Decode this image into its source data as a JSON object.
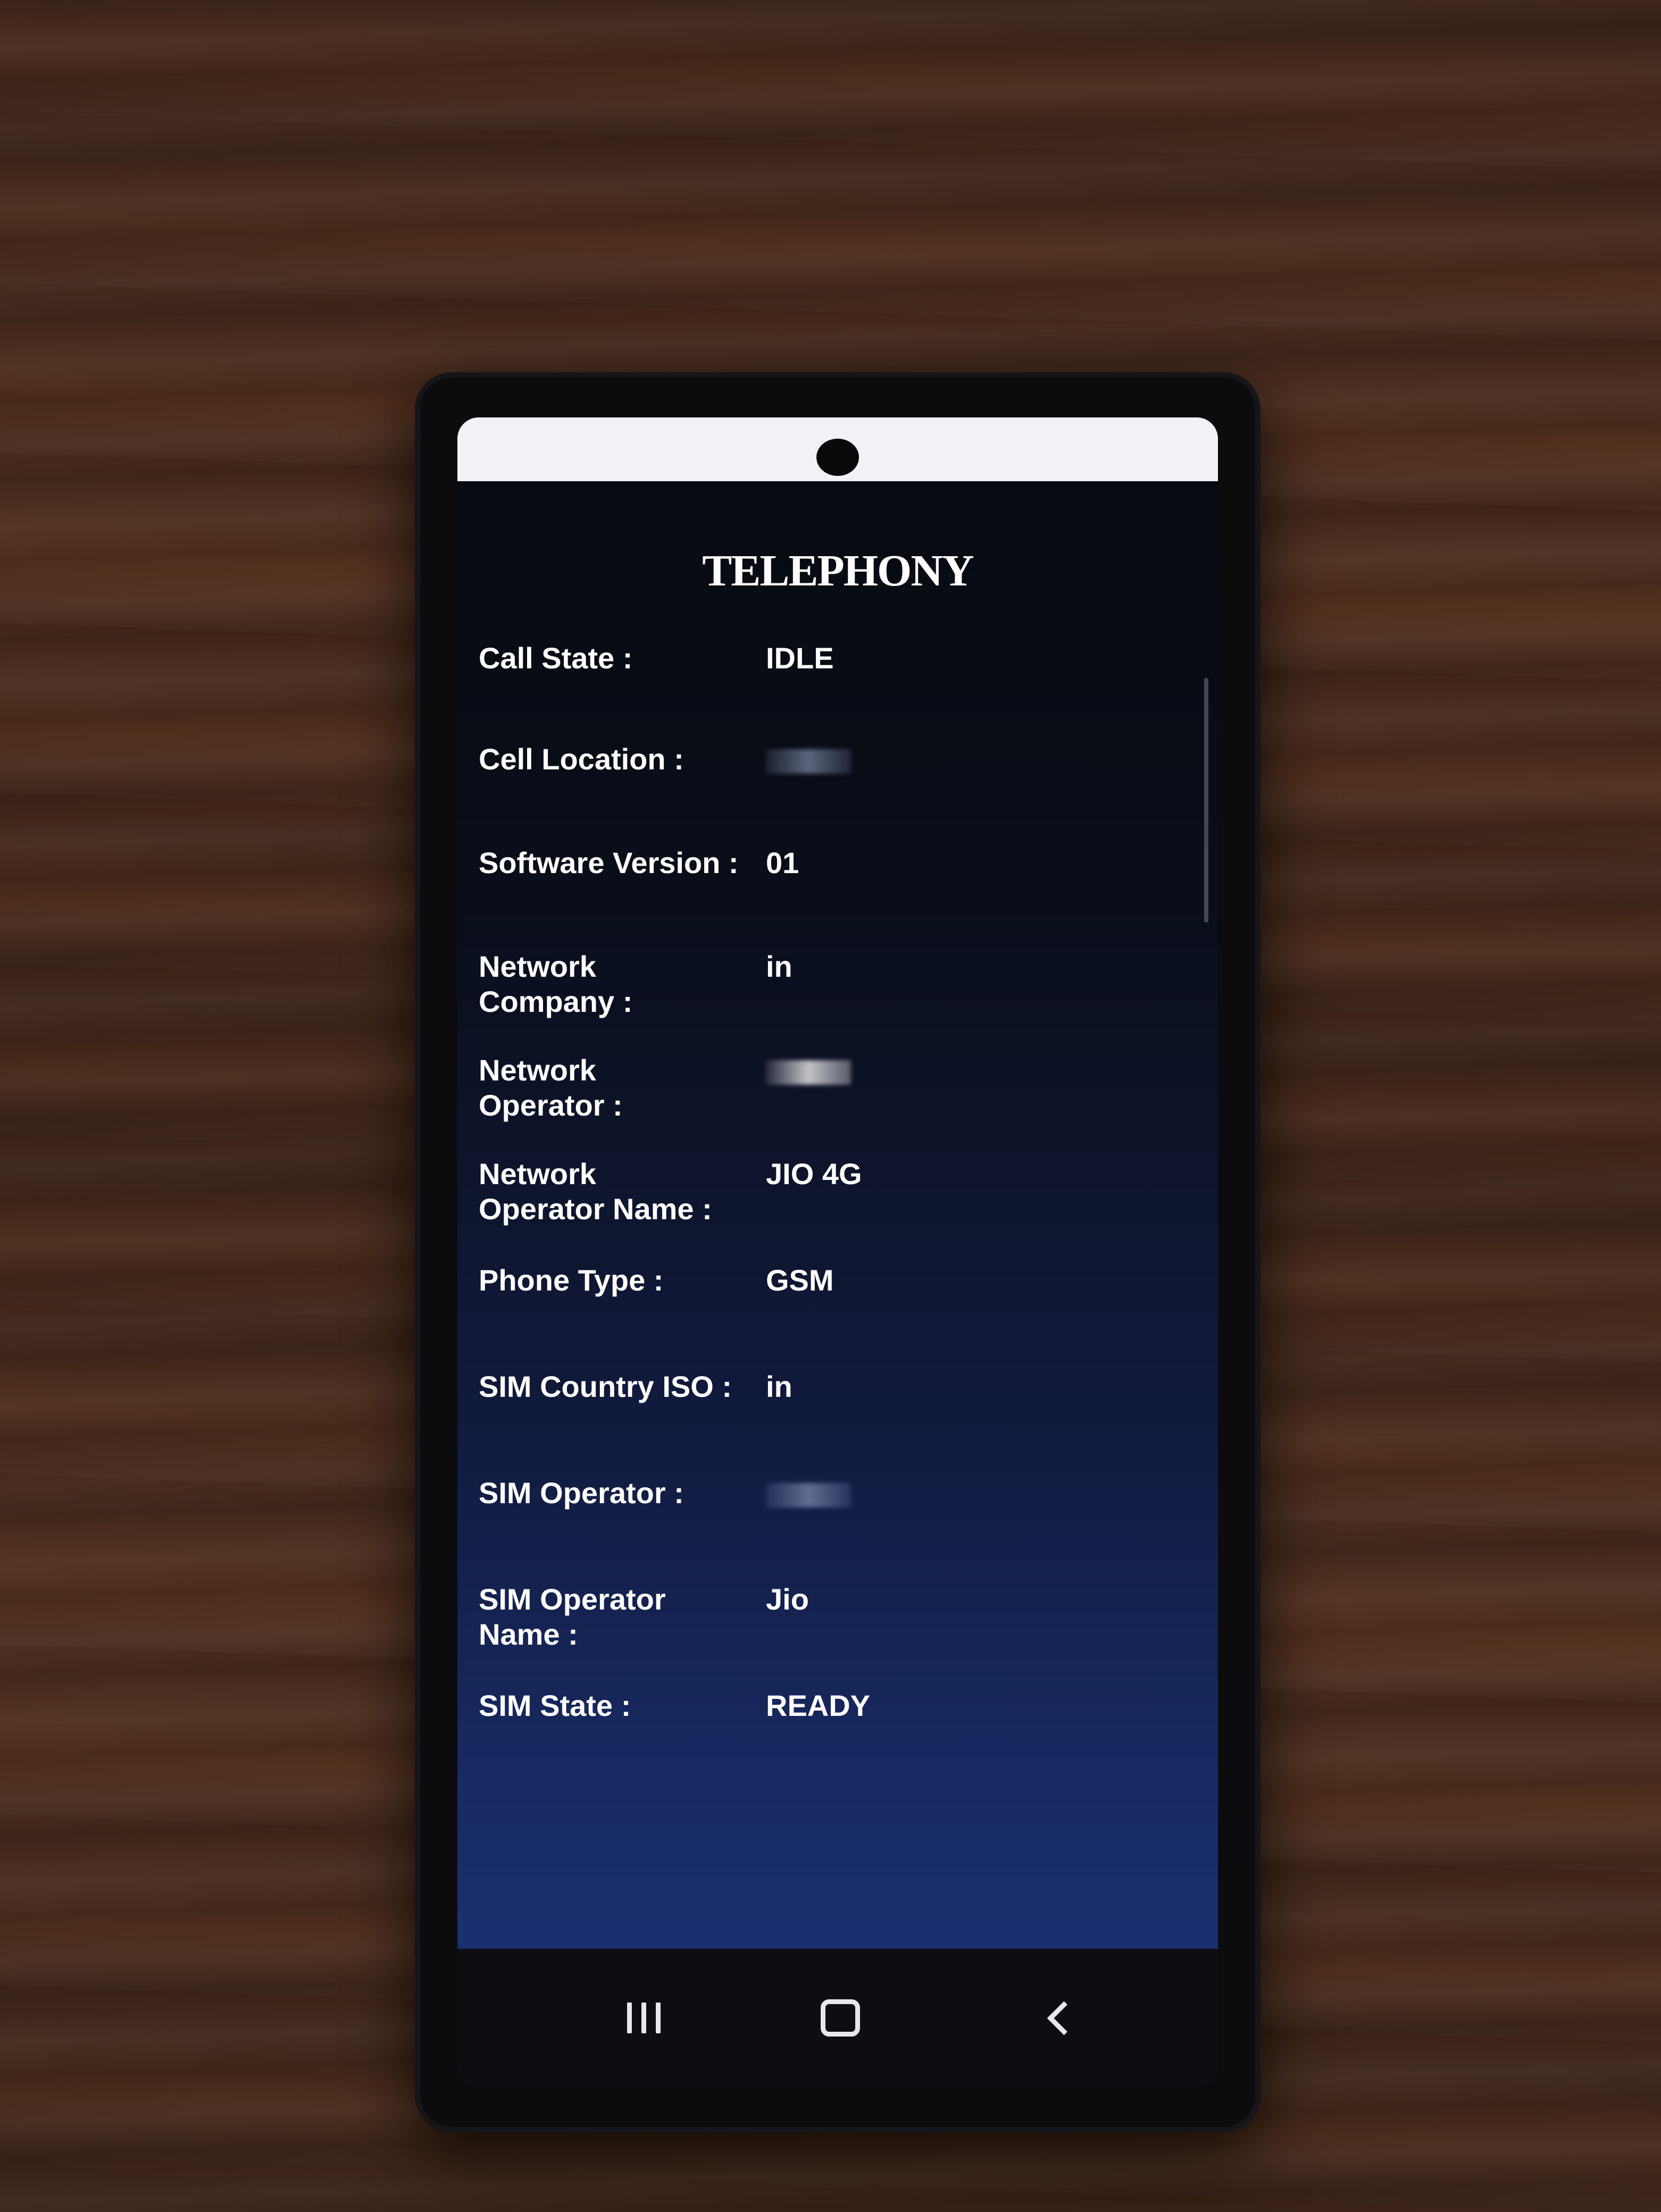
{
  "app": {
    "title": "TELEPHONY"
  },
  "info_rows": [
    {
      "label": "Call State :",
      "value": "IDLE"
    },
    {
      "label": "Cell Location :",
      "value": ""
    },
    {
      "label": "Software Version :",
      "value": "01"
    },
    {
      "label": "Network\n Company :",
      "value": "in"
    },
    {
      "label": "Network\n Operator :",
      "value": ""
    },
    {
      "label": "Network\nOperator Name :",
      "value": "JIO 4G"
    },
    {
      "label": "Phone Type :",
      "value": "GSM"
    },
    {
      "label": "SIM Country ISO :",
      "value": "in"
    },
    {
      "label": "SIM Operator  :",
      "value": ""
    },
    {
      "label": "SIM Operator\n Name :",
      "value": "Jio"
    },
    {
      "label": "SIM State :",
      "value": "READY"
    }
  ],
  "nav": {
    "recents_icon": "recents-icon",
    "home_icon": "home-icon",
    "back_icon": "back-icon"
  },
  "colors": {
    "text": "#ffffff",
    "screen_top": "#070a10",
    "screen_bottom": "#1d3578",
    "status_bar": "#f2f2f6"
  }
}
